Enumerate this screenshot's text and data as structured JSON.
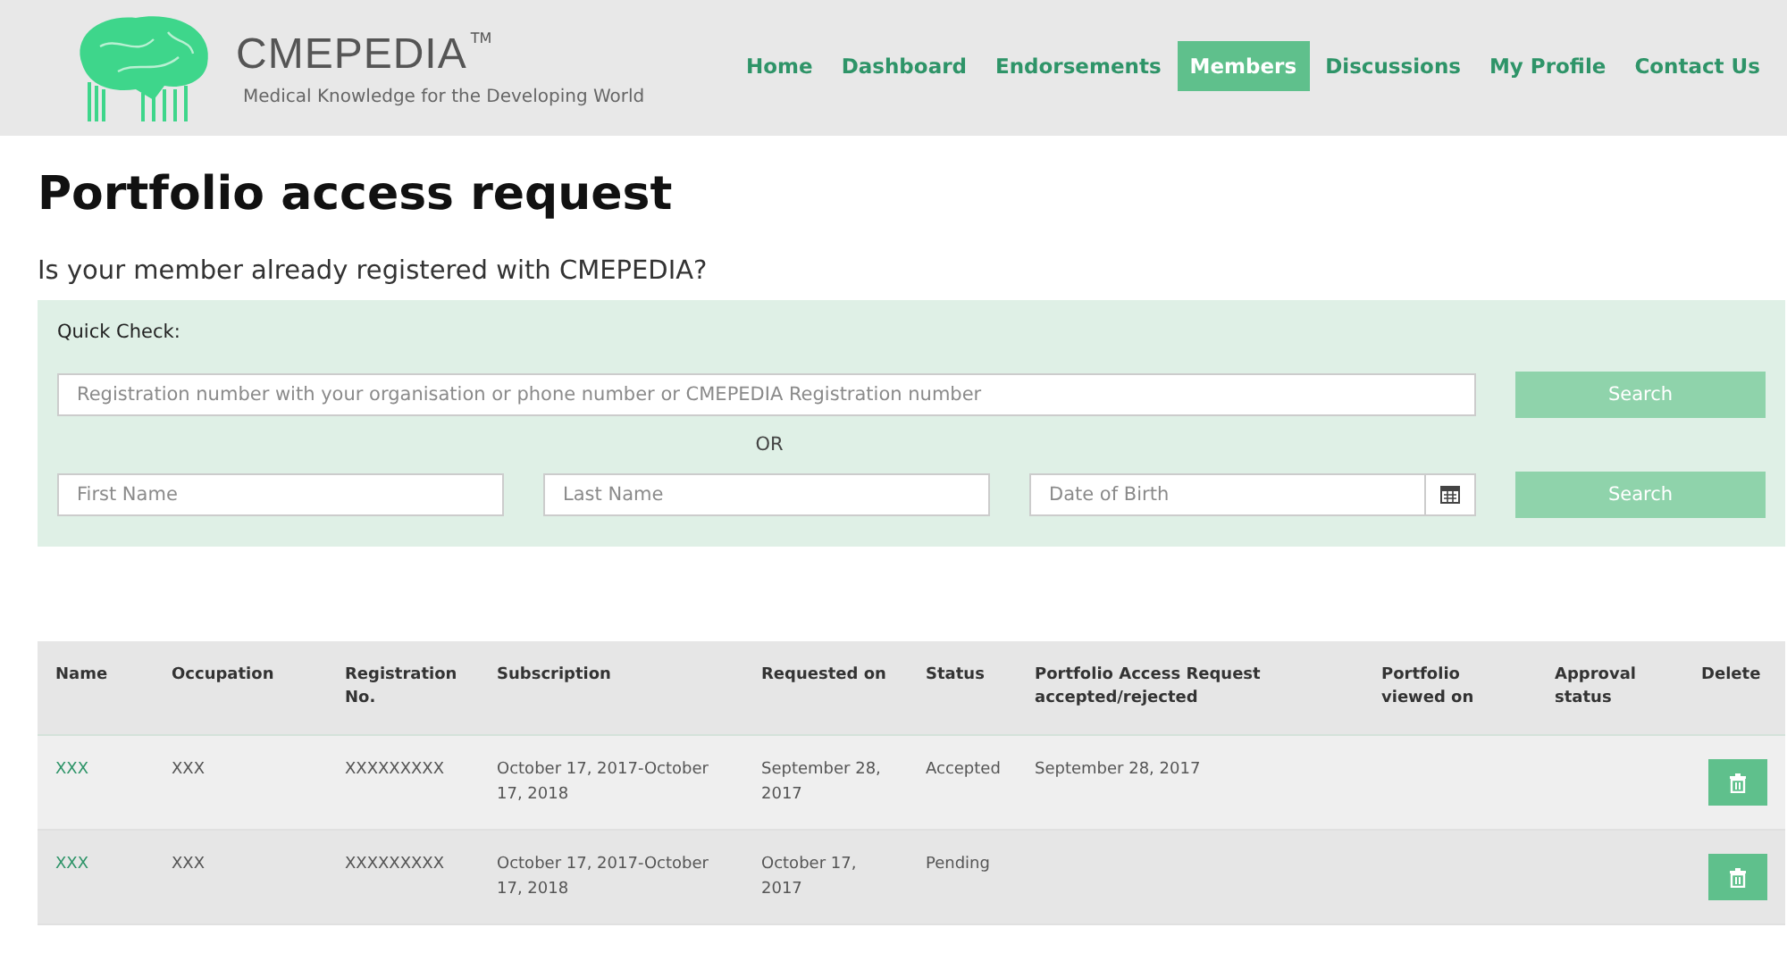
{
  "header": {
    "logo_text": "CMEPEDIA",
    "trademark": "TM",
    "tagline": "Medical Knowledge for the Developing World"
  },
  "nav": [
    {
      "label": "Home",
      "selected": false
    },
    {
      "label": "Dashboard",
      "selected": false
    },
    {
      "label": "Endorsements",
      "selected": false
    },
    {
      "label": "Members",
      "selected": true
    },
    {
      "label": "Discussions",
      "selected": false
    },
    {
      "label": "My Profile",
      "selected": false
    },
    {
      "label": "Contact Us",
      "selected": false
    }
  ],
  "title": "Portfolio access request",
  "subtitle": "Is your member already registered with CMEPEDIA?",
  "quick_check": {
    "label": "Quick Check:",
    "registration_field": {
      "placeholder": "Registration number with your organisation or phone number or CMEPEDIA Registration number"
    },
    "search_button": "Search",
    "or_text": "OR",
    "first_name": {
      "placeholder": "First Name"
    },
    "last_name": {
      "placeholder": "Last Name"
    },
    "date_of_birth": {
      "placeholder": "Date of Birth"
    },
    "search_button_2": "Search"
  },
  "table": {
    "columns": [
      "Name",
      "Occupation",
      "Registration No.",
      "Subscription",
      "Requested on",
      "Status",
      "Portfolio Access Request accepted/rejected",
      "Portfolio viewed on",
      "Approval status",
      "Delete"
    ],
    "rows": [
      {
        "name": "XXX",
        "occupation": "XXX",
        "registration": "XXXXXXXXX",
        "subscription": "October 17, 2017-October 17, 2018",
        "requested_on": "September 28, 2017",
        "status": "Accepted",
        "accepted_on": "September 28, 2017"
      },
      {
        "name": "XXX",
        "occupation": "XXX",
        "registration": "XXXXXXXXX",
        "subscription": "October 17, 2017-October 17, 2018",
        "requested_on": "October 17, 2017",
        "status": "Pending"
      }
    ]
  }
}
